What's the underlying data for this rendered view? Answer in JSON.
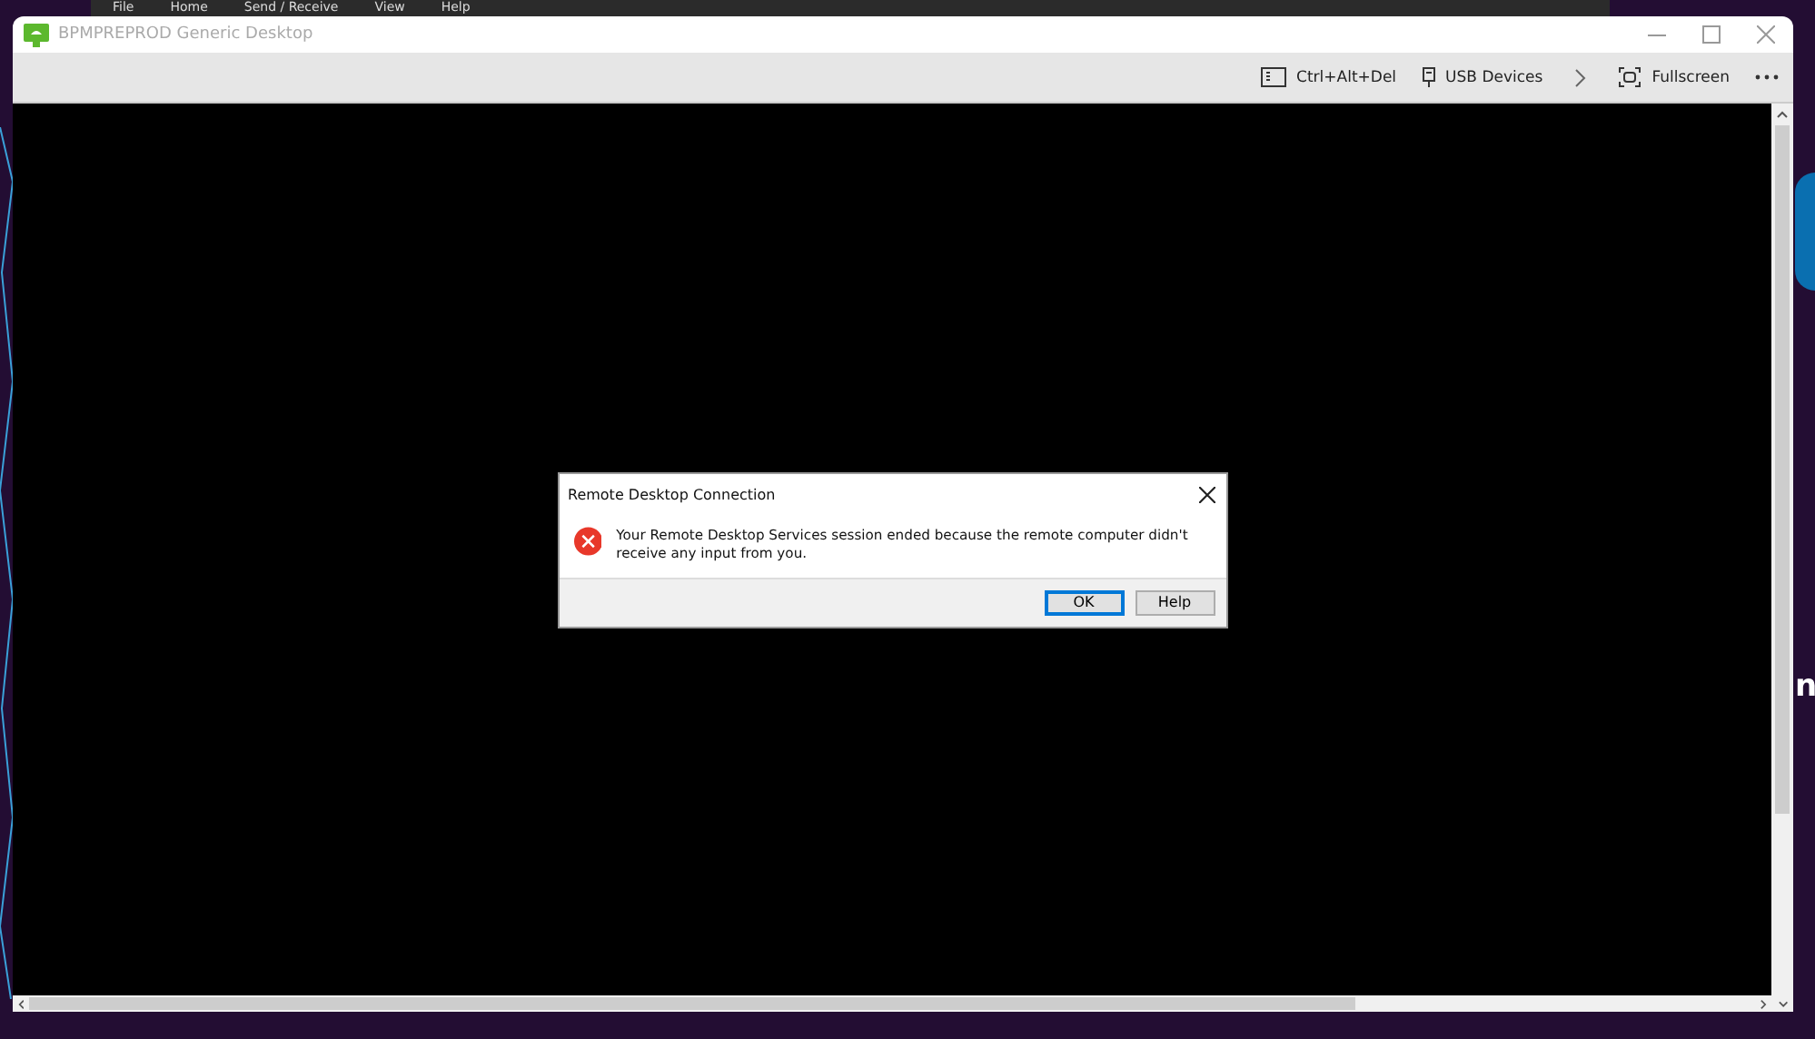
{
  "background_app": {
    "menu": [
      "File",
      "Home",
      "Send / Receive",
      "View",
      "Help"
    ]
  },
  "desktop": {
    "text_fragment": "n"
  },
  "window": {
    "title": "BPMPREPROD Generic Desktop",
    "toolbar": [
      {
        "kind": "keyboard",
        "label": "Ctrl+Alt+Del"
      },
      {
        "kind": "usb",
        "label": "USB Devices"
      },
      {
        "kind": "chevron"
      },
      {
        "kind": "fullscreen",
        "label": "Fullscreen"
      },
      {
        "kind": "more"
      }
    ]
  },
  "dialog": {
    "title": "Remote Desktop Connection",
    "message": "Your Remote Desktop Services session ended because the remote computer didn't receive any input from you.",
    "buttons": [
      {
        "label": "OK",
        "selected": true
      },
      {
        "label": "Help",
        "selected": false
      }
    ]
  }
}
